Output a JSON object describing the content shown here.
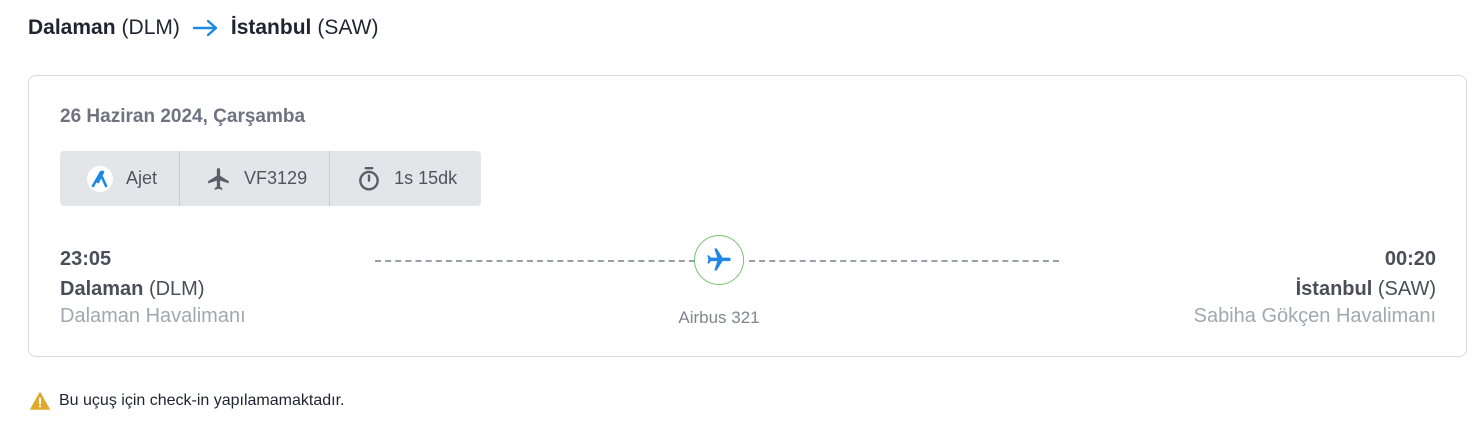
{
  "route": {
    "origin_city": "Dalaman",
    "origin_code": "(DLM)",
    "destination_city": "İstanbul",
    "destination_code": "(SAW)",
    "arrow_icon": "arrow-right-icon",
    "arrow_color": "#1e88e5"
  },
  "flight": {
    "date": "26 Haziran 2024, Çarşamba",
    "airline": {
      "icon": "ajet-logo-icon",
      "label": "Ajet"
    },
    "flight_number": {
      "icon": "plane-icon",
      "label": "VF3129"
    },
    "duration": {
      "icon": "stopwatch-icon",
      "label": "1s 15dk"
    },
    "departure": {
      "time": "23:05",
      "city": "Dalaman",
      "code": "(DLM)",
      "airport": "Dalaman Havalimanı"
    },
    "arrival": {
      "time": "00:20",
      "city": "İstanbul",
      "code": "(SAW)",
      "airport": "Sabiha Gökçen Havalimanı"
    },
    "aircraft": "Airbus 321",
    "plane_marker": {
      "icon": "plane-icon",
      "color": "#1e88e5",
      "ring_color": "#77c36f"
    }
  },
  "notice": {
    "icon": "warning-icon",
    "icon_color": "#e0a82e",
    "text": "Bu uçuş için check-in yapılamamaktadır."
  }
}
